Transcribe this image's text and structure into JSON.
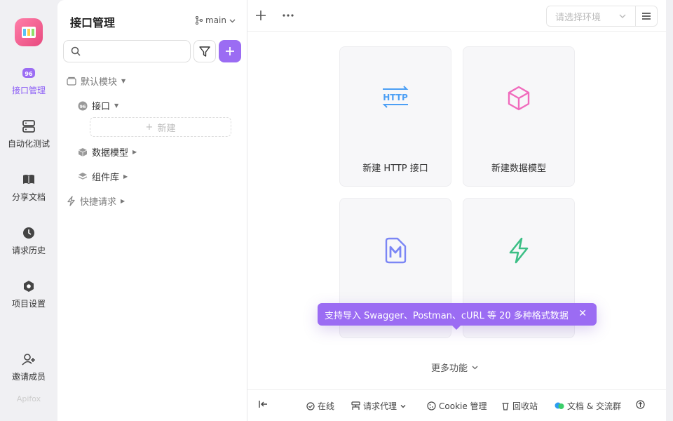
{
  "nav": {
    "items": [
      {
        "label": "接口管理",
        "icon": "api-icon",
        "active": true
      },
      {
        "label": "自动化测试",
        "icon": "automation-icon"
      },
      {
        "label": "分享文档",
        "icon": "book-icon"
      },
      {
        "label": "请求历史",
        "icon": "clock-icon"
      },
      {
        "label": "项目设置",
        "icon": "settings-hex-icon"
      },
      {
        "label": "邀请成员",
        "icon": "user-add-icon"
      }
    ],
    "watermark": "Apifox"
  },
  "panel": {
    "title": "接口管理",
    "branch": "main",
    "search_placeholder": "",
    "tree": {
      "default_module": "默认模块",
      "api": "接口",
      "new": "新建",
      "data_model": "数据模型",
      "components": "组件库",
      "quick_request": "快捷请求"
    }
  },
  "main": {
    "env_placeholder": "请选择环境",
    "cards": [
      {
        "label": "新建 HTTP 接口",
        "icon": "http-icon",
        "color": "#4c9ff5"
      },
      {
        "label": "新建数据模型",
        "icon": "cube-icon",
        "color": "#f06bbd"
      },
      {
        "label": "",
        "icon": "markdown-icon",
        "color": "#7b86f5"
      },
      {
        "label": "",
        "icon": "lightning-icon",
        "color": "#3cbf86"
      }
    ],
    "tooltip": "支持导入 Swagger、Postman、cURL 等 20 多种格式数据",
    "more": "更多功能"
  },
  "status": {
    "online": "在线",
    "proxy": "请求代理",
    "cookie": "Cookie 管理",
    "recycle": "回收站",
    "docs": "文档 & 交流群"
  },
  "colors": {
    "accent": "#9b6cf3"
  }
}
